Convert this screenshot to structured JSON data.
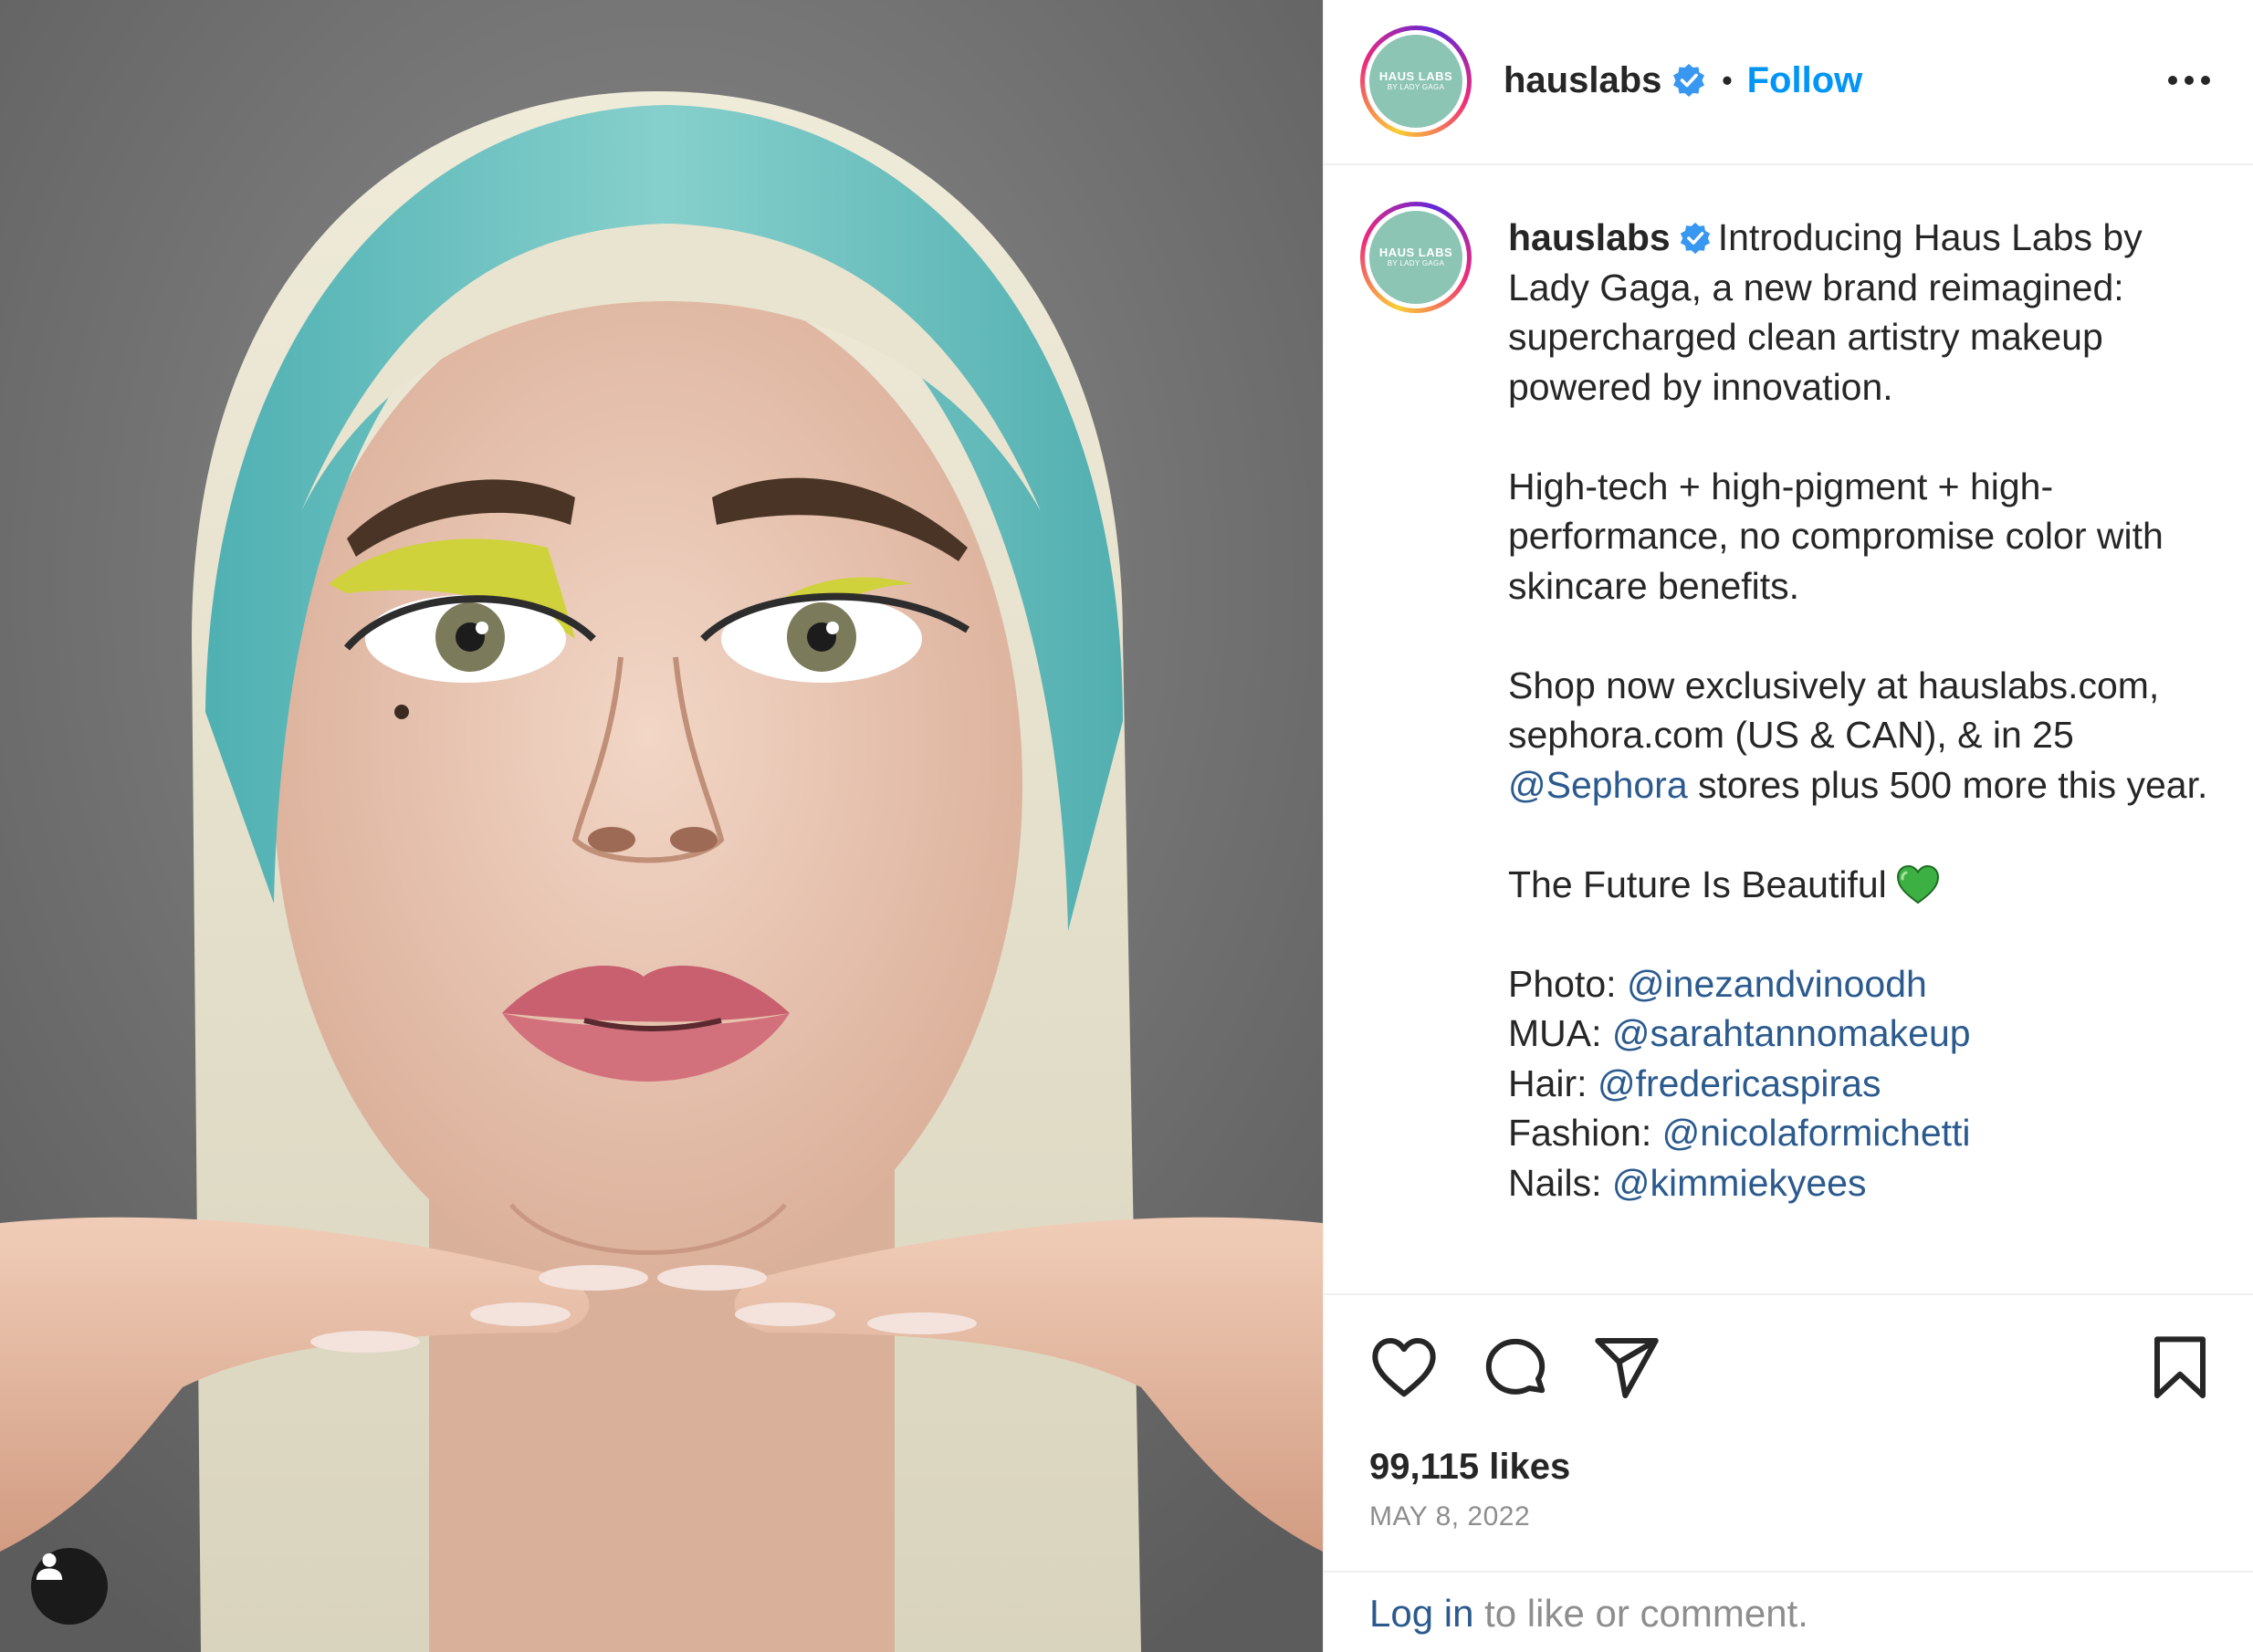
{
  "post": {
    "username": "hauslabs",
    "avatar_line1": "HAUS LABS",
    "avatar_line2": "BY LADY GAGA",
    "follow_label": "Follow",
    "separator": "•"
  },
  "caption": {
    "intro": "Introducing Haus Labs by Lady Gaga, a new brand reimagined: supercharged clean artistry makeup powered by innovation.",
    "p2": "High-tech + high-pigment + high-performance, no compromise color with skincare benefits.",
    "p3_a": "Shop now exclusively at hauslabs.com, sephora.com (US & CAN), & in 25 ",
    "p3_mention": "@Sephora",
    "p3_b": " stores plus 500 more this year.",
    "p4": "The Future Is Beautiful",
    "credits": [
      {
        "label": "Photo: ",
        "handle": "@inezandvinoodh"
      },
      {
        "label": "MUA: ",
        "handle": "@sarahtannomakeup"
      },
      {
        "label": "Hair: ",
        "handle": "@fredericaspiras"
      },
      {
        "label": "Fashion: ",
        "handle": "@nicolaformichetti"
      },
      {
        "label": "Nails: ",
        "handle": "@kimmiekyees"
      }
    ]
  },
  "stats": {
    "likes": "99,115 likes",
    "date": "MAY 8, 2022"
  },
  "login": {
    "link": "Log in",
    "rest": " to like or comment."
  },
  "colors": {
    "follow": "#0095f6",
    "mention": "#2b5a8e",
    "avatar_bg": "#8dc5b5",
    "verified": "#3897f0",
    "heart_emoji": "#3cb043"
  },
  "icons": {
    "like": "heart-outline-icon",
    "comment": "speech-bubble-icon",
    "share": "paper-plane-icon",
    "save": "bookmark-icon",
    "more": "ellipsis-icon",
    "tag": "user-icon"
  }
}
